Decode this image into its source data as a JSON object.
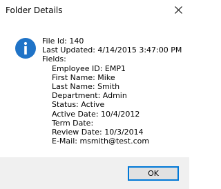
{
  "window": {
    "title": "Folder Details",
    "close_icon": "close-icon"
  },
  "message": {
    "icon": "info-icon",
    "accent_color": "#1f73c7",
    "file_id": "File Id: 140",
    "last_updated": "Last Updated: 4/14/2015 3:47:00 PM",
    "fields_label": "Fields:",
    "fields": [
      "Employee ID:  EMP1",
      "First Name:  Mike",
      "Last Name:  Smith",
      "Department:  Admin",
      "Status:  Active",
      "Active Date:  10/4/2012",
      "Term Date:",
      "Review Date:  10/3/2014",
      "E-Mail:  msmith@test.com"
    ]
  },
  "buttons": {
    "ok_label": "OK",
    "focus_color": "#0078d7"
  }
}
